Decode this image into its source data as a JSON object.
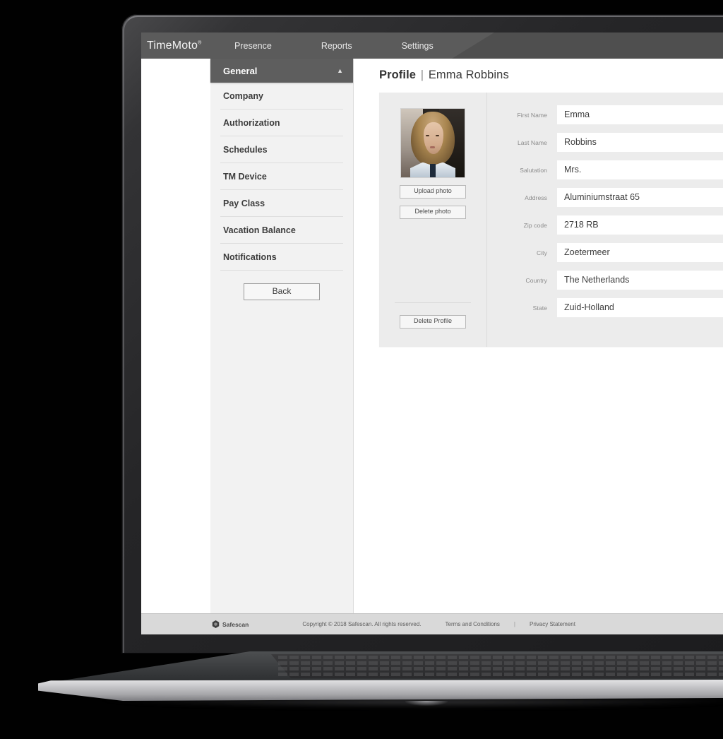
{
  "app": {
    "logo_text": "TimeMoto",
    "logo_reg": "®"
  },
  "topnav": {
    "items": [
      {
        "label": "Presence",
        "name": "nav-presence"
      },
      {
        "label": "Reports",
        "name": "nav-reports"
      },
      {
        "label": "Settings",
        "name": "nav-settings"
      }
    ]
  },
  "sidebar": {
    "header": {
      "label": "General",
      "chevron": "▲"
    },
    "items": [
      {
        "label": "Company"
      },
      {
        "label": "Authorization"
      },
      {
        "label": "Schedules"
      },
      {
        "label": "TM Device"
      },
      {
        "label": "Pay Class"
      },
      {
        "label": "Vacation Balance"
      },
      {
        "label": "Notifications"
      }
    ],
    "back_label": "Back"
  },
  "page": {
    "title": "Profile",
    "separator": "|",
    "subject": "Emma Robbins"
  },
  "photo_panel": {
    "upload_label": "Upload photo",
    "delete_photo_label": "Delete photo",
    "delete_profile_label": "Delete Profile",
    "avatar_alt": "Emma Robbins portrait"
  },
  "form": {
    "fields": [
      {
        "label": "First Name",
        "value": "Emma"
      },
      {
        "label": "Last Name",
        "value": "Robbins"
      },
      {
        "label": "Salutation",
        "value": "Mrs."
      },
      {
        "label": "Address",
        "value": "Aluminiumstraat 65"
      },
      {
        "label": "Zip code",
        "value": "2718 RB"
      },
      {
        "label": "City",
        "value": "Zoetermeer"
      },
      {
        "label": "Country",
        "value": "The Netherlands"
      },
      {
        "label": "State",
        "value": "Zuid-Holland"
      }
    ]
  },
  "footer": {
    "brand": "Safescan",
    "copyright": "Copyright © 2018 Safescan. All rights reserved.",
    "terms": "Terms and Conditions",
    "separator": "|",
    "privacy": "Privacy Statement"
  },
  "colors": {
    "nav_bg": "#5b5b5b",
    "nav_bg_dark": "#4f4f4f",
    "sidebar_bg": "#f2f2f2",
    "sidebar_head_bg": "#5e5e5e",
    "panel_bg": "#ececec",
    "footer_bg": "#d9d9d9",
    "text_dark": "#3c3c3c",
    "label_gray": "#8a8a8a"
  }
}
